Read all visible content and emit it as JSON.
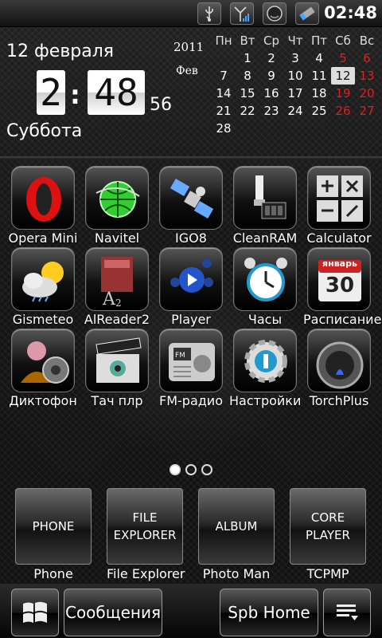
{
  "status_bar": {
    "icons": [
      "usb-icon",
      "signal-icon",
      "battery-icon",
      "edit-icon"
    ],
    "time": "02:48"
  },
  "widget": {
    "date": "12 февраля",
    "hour": "2",
    "minutes": "48",
    "seconds": "56",
    "weekday": "Суббота",
    "year": "2011",
    "month_short": "Фев",
    "calendar": {
      "headers": [
        "Пн",
        "Вт",
        "Ср",
        "Чт",
        "Пт",
        "Сб",
        "Вс"
      ],
      "weeks": [
        [
          "",
          "1",
          "2",
          "3",
          "4",
          "5",
          "6"
        ],
        [
          "7",
          "8",
          "9",
          "10",
          "11",
          "12",
          "13"
        ],
        [
          "14",
          "15",
          "16",
          "17",
          "18",
          "19",
          "20"
        ],
        [
          "21",
          "22",
          "23",
          "24",
          "25",
          "26",
          "27"
        ],
        [
          "28",
          "",
          "",
          "",
          "",
          "",
          ""
        ]
      ],
      "today": "12",
      "weekend_color": "#e02020"
    }
  },
  "apps": [
    {
      "label": "Opera Mini",
      "icon": "opera-icon"
    },
    {
      "label": "Navitel",
      "icon": "navitel-icon"
    },
    {
      "label": "IGO8",
      "icon": "satellite-icon"
    },
    {
      "label": "CleanRAM",
      "icon": "memory-brush-icon"
    },
    {
      "label": "Calculator",
      "icon": "calculator-icon"
    },
    {
      "label": "Gismeteo",
      "icon": "weather-icon"
    },
    {
      "label": "AlReader2",
      "icon": "book-icon"
    },
    {
      "label": "Player",
      "icon": "player-icon"
    },
    {
      "label": "Часы",
      "icon": "alarm-clock-icon"
    },
    {
      "label": "Расписание",
      "icon": "calendar-icon"
    },
    {
      "label": "Диктофон",
      "icon": "dictaphone-icon"
    },
    {
      "label": "Тач плр",
      "icon": "clapperboard-icon"
    },
    {
      "label": "FM-радио",
      "icon": "radio-icon"
    },
    {
      "label": "Настройки",
      "icon": "settings-icon"
    },
    {
      "label": "TorchPlus",
      "icon": "torch-icon"
    }
  ],
  "calendar_icon_text": {
    "month": "январь",
    "day": "30"
  },
  "page_indicator": {
    "count": 3,
    "active": 0
  },
  "dock": [
    {
      "button": "PHONE",
      "label": "Phone"
    },
    {
      "button": "FILE EXPLORER",
      "label": "File Explorer"
    },
    {
      "button": "ALBUM",
      "label": "Photo Man"
    },
    {
      "button": "CORE PLAYER",
      "label": "TCPMP"
    }
  ],
  "bottom_bar": {
    "start_icon": "windows-flag-icon",
    "messages": "Сообщения",
    "spb": "Spb Home",
    "menu_icon": "menu-icon"
  }
}
